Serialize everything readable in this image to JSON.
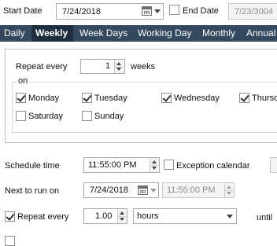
{
  "header": {
    "start_date_label": "Start Date",
    "start_date_value": "7/24/2018",
    "end_date_label": "End Date",
    "end_date_value": "7/23/3004",
    "end_date_checked": false
  },
  "tabs": [
    {
      "label": "Daily",
      "active": false
    },
    {
      "label": "Weekly",
      "active": true
    },
    {
      "label": "Week Days",
      "active": false
    },
    {
      "label": "Working Day",
      "active": false
    },
    {
      "label": "Monthly",
      "active": false
    },
    {
      "label": "Annual",
      "active": false
    }
  ],
  "weekly": {
    "repeat_label": "Repeat every",
    "repeat_value": "1",
    "repeat_unit": "weeks",
    "on_label": "on",
    "days": [
      {
        "label": "Monday",
        "checked": true
      },
      {
        "label": "Tuesday",
        "checked": true
      },
      {
        "label": "Wednesday",
        "checked": true
      },
      {
        "label": "Thursday",
        "checked": true
      },
      {
        "label": "Saturday",
        "checked": false
      },
      {
        "label": "Sunday",
        "checked": false
      }
    ]
  },
  "schedule": {
    "time_label": "Schedule time",
    "time_value": "11:55:00 PM",
    "exception_label": "Exception calendar",
    "exception_checked": false,
    "next_run_label": "Next to run on",
    "next_run_date": "7/24/2018",
    "next_run_time": "11:55:00 PM",
    "repeat_label": "Repeat every",
    "repeat_checked": true,
    "repeat_value": "1.00",
    "repeat_unit": "hours",
    "until_label": "until"
  },
  "colors": {
    "tabbar_bg": "#34495f",
    "tab_active_bg": "#1e2e3e"
  }
}
